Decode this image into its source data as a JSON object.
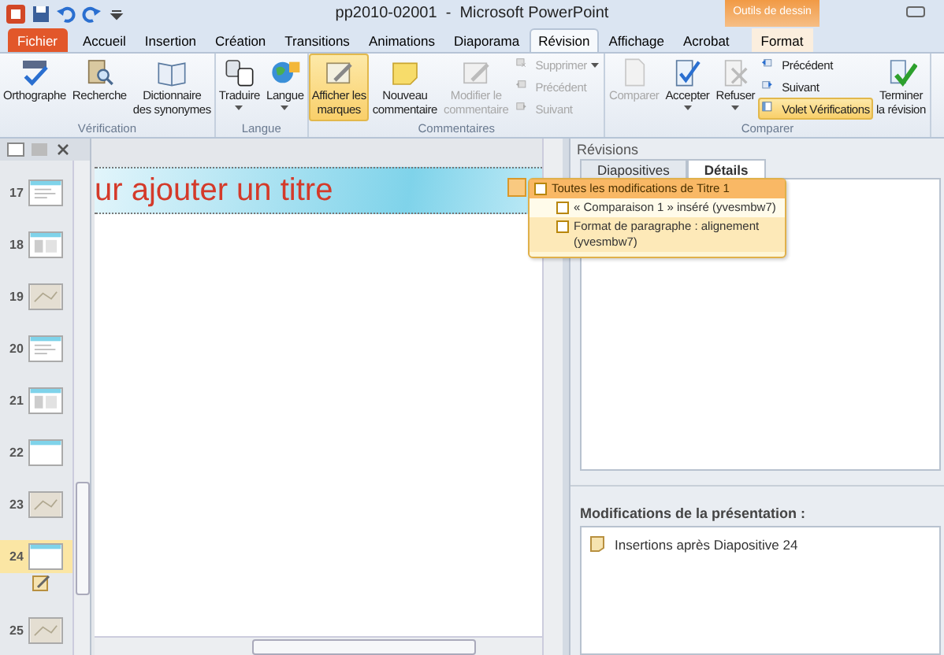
{
  "window": {
    "title": "pp2010-02001  -  Microsoft PowerPoint",
    "context_label": "Outils de dessin"
  },
  "tabs": [
    {
      "label": "Fichier",
      "kind": "file",
      "selected": false
    },
    {
      "label": "Accueil",
      "kind": "normal",
      "selected": false
    },
    {
      "label": "Insertion",
      "kind": "normal",
      "selected": false
    },
    {
      "label": "Création",
      "kind": "normal",
      "selected": false
    },
    {
      "label": "Transitions",
      "kind": "normal",
      "selected": false
    },
    {
      "label": "Animations",
      "kind": "normal",
      "selected": false
    },
    {
      "label": "Diaporama",
      "kind": "normal",
      "selected": false
    },
    {
      "label": "Révision",
      "kind": "normal",
      "selected": true
    },
    {
      "label": "Affichage",
      "kind": "normal",
      "selected": false
    },
    {
      "label": "Acrobat",
      "kind": "normal",
      "selected": false
    },
    {
      "label": "Format",
      "kind": "context",
      "selected": false
    }
  ],
  "ribbon": {
    "groups": [
      {
        "label": "Vérification",
        "buttons": [
          {
            "label": "Orthographe",
            "kind": "large",
            "disabled": false,
            "highlighted": false,
            "dropdown": false
          },
          {
            "label": "Recherche",
            "kind": "large",
            "disabled": false,
            "highlighted": false,
            "dropdown": false
          },
          {
            "label": "Dictionnaire\ndes synonymes",
            "kind": "large",
            "disabled": false,
            "highlighted": false,
            "dropdown": false
          }
        ]
      },
      {
        "label": "Langue",
        "buttons": [
          {
            "label": "Traduire",
            "kind": "large",
            "disabled": false,
            "highlighted": false,
            "dropdown": true
          },
          {
            "label": "Langue",
            "kind": "large",
            "disabled": false,
            "highlighted": false,
            "dropdown": true
          }
        ]
      },
      {
        "label": "Commentaires",
        "buttons": [
          {
            "label": "Afficher les\nmarques",
            "kind": "large",
            "disabled": false,
            "highlighted": true,
            "dropdown": false
          },
          {
            "label": "Nouveau\ncommentaire",
            "kind": "large",
            "disabled": false,
            "highlighted": false,
            "dropdown": false
          },
          {
            "label": "Modifier le\ncommentaire",
            "kind": "large",
            "disabled": true,
            "highlighted": false,
            "dropdown": false
          },
          {
            "label": "Supprimer",
            "kind": "small",
            "disabled": true,
            "highlighted": false,
            "dropdown": true
          },
          {
            "label": "Précédent",
            "kind": "small",
            "disabled": true,
            "highlighted": false,
            "dropdown": false
          },
          {
            "label": "Suivant",
            "kind": "small",
            "disabled": true,
            "highlighted": false,
            "dropdown": false
          }
        ]
      },
      {
        "label": "Comparer",
        "buttons": [
          {
            "label": "Comparer",
            "kind": "large",
            "disabled": true,
            "highlighted": false,
            "dropdown": false
          },
          {
            "label": "Accepter",
            "kind": "large",
            "disabled": false,
            "highlighted": false,
            "dropdown": true
          },
          {
            "label": "Refuser",
            "kind": "large",
            "disabled": false,
            "highlighted": false,
            "dropdown": true
          },
          {
            "label": "Précédent",
            "kind": "small",
            "disabled": false,
            "highlighted": false,
            "dropdown": false
          },
          {
            "label": "Suivant",
            "kind": "small",
            "disabled": false,
            "highlighted": false,
            "dropdown": false
          },
          {
            "label": "Volet Vérifications",
            "kind": "small",
            "disabled": false,
            "highlighted": true,
            "dropdown": false
          },
          {
            "label": "Terminer\nla révision",
            "kind": "large",
            "disabled": false,
            "highlighted": false,
            "dropdown": false
          }
        ]
      }
    ]
  },
  "slides_panel": {
    "slides": [
      {
        "number": "17",
        "kind": "text",
        "selected": false,
        "marked": false
      },
      {
        "number": "18",
        "kind": "table",
        "selected": false,
        "marked": false
      },
      {
        "number": "19",
        "kind": "image",
        "selected": false,
        "marked": false
      },
      {
        "number": "20",
        "kind": "text",
        "selected": false,
        "marked": false
      },
      {
        "number": "21",
        "kind": "table",
        "selected": false,
        "marked": false
      },
      {
        "number": "22",
        "kind": "blank",
        "selected": false,
        "marked": false
      },
      {
        "number": "23",
        "kind": "image",
        "selected": false,
        "marked": false
      },
      {
        "number": "24",
        "kind": "blank",
        "selected": true,
        "marked": true
      },
      {
        "number": "25",
        "kind": "image",
        "selected": false,
        "marked": false
      }
    ]
  },
  "slide": {
    "title": "ur ajouter un titre"
  },
  "revision_popup": {
    "items": [
      {
        "label": "Toutes les modifications de Titre 1",
        "checked": false,
        "children": [
          {
            "label": "« Comparaison 1 » inséré (yvesmbw7)",
            "checked": false
          },
          {
            "label": "Format de paragraphe : alignement (yvesmbw7)",
            "checked": false
          }
        ]
      }
    ]
  },
  "revisions_pane": {
    "title": "Révisions",
    "tabs": [
      {
        "label": "Diapositives",
        "selected": false
      },
      {
        "label": "Détails",
        "selected": true
      }
    ],
    "presentation_changes": {
      "heading": "Modifications de la présentation :",
      "items": [
        "Insertions après Diapositive 24"
      ]
    }
  }
}
